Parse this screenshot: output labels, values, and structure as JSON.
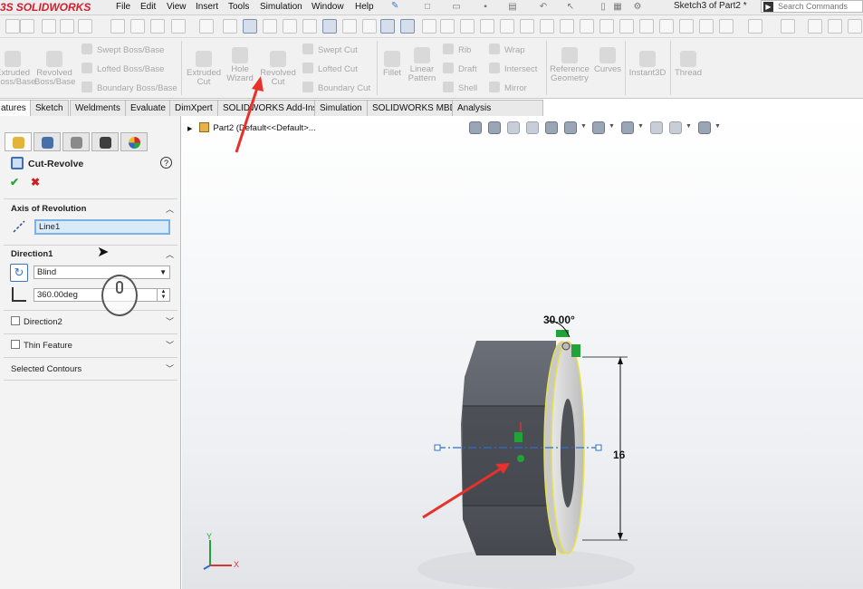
{
  "app": {
    "brand": "SOLIDWORKS",
    "brand_prefix": "3S",
    "doc_title": "Sketch3 of Part2 *",
    "menu": [
      "File",
      "Edit",
      "View",
      "Insert",
      "Tools",
      "Simulation",
      "Window",
      "Help"
    ],
    "search_placeholder": "Search Commands"
  },
  "command_manager": {
    "features": [
      {
        "label": "Extruded\nBoss/Base"
      },
      {
        "label": "Revolved\nBoss/Base"
      },
      {
        "label": "Extruded\nCut"
      },
      {
        "label": "Hole\nWizard"
      },
      {
        "label": "Revolved\nCut"
      },
      {
        "label": "Fillet"
      },
      {
        "label": "Linear\nPattern"
      },
      {
        "label": "Reference\nGeometry"
      },
      {
        "label": "Curves"
      },
      {
        "label": "Instant3D"
      },
      {
        "label": "Thread"
      }
    ],
    "stacked": {
      "col1": [
        "Swept Boss/Base",
        "Lofted Boss/Base",
        "Boundary Boss/Base"
      ],
      "col2": [
        "Swept Cut",
        "Lofted Cut",
        "Boundary Cut"
      ],
      "col3": [
        "Rib",
        "Draft",
        "Shell"
      ],
      "col4": [
        "Wrap",
        "Intersect",
        "Mirror"
      ]
    }
  },
  "tabs": [
    "Features",
    "Sketch",
    "Weldments",
    "Evaluate",
    "DimXpert",
    "SOLIDWORKS Add-Ins",
    "Simulation",
    "SOLIDWORKS MBD",
    "Analysis Preparation"
  ],
  "tabs_visible_labels": [
    "atures",
    "Sketch",
    "Weldments",
    "Evaluate",
    "DimXpert",
    "SOLIDWORKS Add-Ins",
    "Simulation",
    "SOLIDWORKS MBD",
    "Analysis Preparation"
  ],
  "property_manager": {
    "title": "Cut-Revolve",
    "axis_section": "Axis of Revolution",
    "axis_value": "Line1",
    "direction1_section": "Direction1",
    "end_condition": "Blind",
    "angle_value": "360.00deg",
    "direction2_label": "Direction2",
    "thin_feature_label": "Thin Feature",
    "selected_contours_label": "Selected Contours"
  },
  "graphics": {
    "tree_label": "Part2  (Default<<Default>...",
    "dim_angle": "30.00°",
    "dim_length": "16",
    "triad_x": "X",
    "triad_y": "Y"
  },
  "colors": {
    "brand_red": "#d3202e",
    "accent_blue": "#3d6fb3",
    "sketch_yellow": "#e6e14a",
    "model_gray": "#5b5f66",
    "annotation_red": "#e8312a",
    "relation_green": "#22a33a"
  }
}
